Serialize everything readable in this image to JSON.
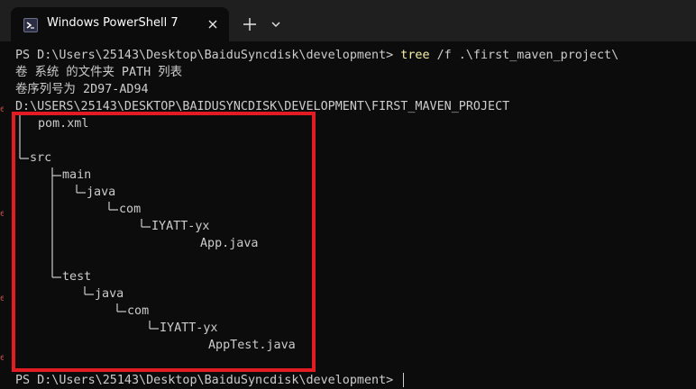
{
  "window": {
    "tab_title": "Windows PowerShell 7",
    "tab_icon": "powershell-icon",
    "close_icon": "close-icon",
    "new_tab_icon": "plus-icon",
    "dropdown_icon": "chevron-down-icon"
  },
  "terminal": {
    "prompt_1": "PS D:\\Users\\25143\\Desktop\\BaiduSyncdisk\\development> ",
    "command_name": "tree",
    "command_args": " /f .\\first_maven_project\\",
    "output_1": "卷 系统 的文件夹 PATH 列表",
    "output_2": "卷序列号为 2D97-AD94",
    "output_3": "D:\\USERS\\25143\\DESKTOP\\BAIDUSYNCDISK\\DEVELOPMENT\\FIRST_MAVEN_PROJECT",
    "prompt_2": "PS D:\\Users\\25143\\Desktop\\BaiduSyncdisk\\development> "
  },
  "tree": {
    "pom": "pom.xml",
    "src": "src",
    "main": "main",
    "main_java": "java",
    "main_com": "com",
    "main_pkg": "IYATT-yx",
    "main_file": "App.java",
    "test": "test",
    "test_java": "java",
    "test_com": "com",
    "test_pkg": "IYATT-yx",
    "test_file": "AppTest.java"
  },
  "colors": {
    "background": "#0c0c0c",
    "titlebar": "#1f1f1f",
    "text": "#cccccc",
    "command": "#f9f1a5",
    "highlight": "#e21c22"
  }
}
